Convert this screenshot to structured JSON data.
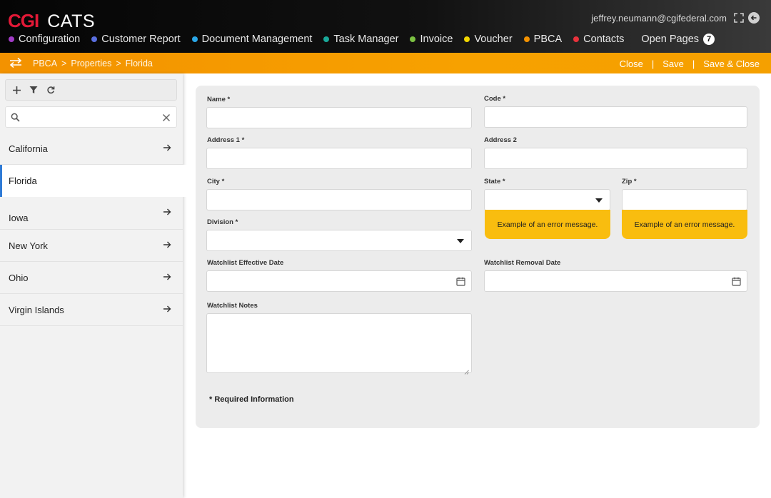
{
  "brand": {
    "logo": "CGI",
    "app_name": "CATS"
  },
  "user": {
    "email": "jeffrey.neumann@cgifederal.com"
  },
  "nav": {
    "items": [
      {
        "label": "Configuration",
        "color": "#a23cc7"
      },
      {
        "label": "Customer Report",
        "color": "#5a6fe0"
      },
      {
        "label": "Document Management",
        "color": "#2aa7e8"
      },
      {
        "label": "Task Manager",
        "color": "#1aa99a"
      },
      {
        "label": "Invoice",
        "color": "#7cc242"
      },
      {
        "label": "Voucher",
        "color": "#f2d600"
      },
      {
        "label": "PBCA",
        "color": "#f39200"
      },
      {
        "label": "Contacts",
        "color": "#e8323c"
      }
    ],
    "open_pages_label": "Open Pages",
    "open_pages_count": "7"
  },
  "breadcrumb": {
    "parts": [
      "PBCA",
      ">",
      "Properties",
      ">",
      "Florida"
    ]
  },
  "actions": {
    "close": "Close",
    "save": "Save",
    "save_close": "Save & Close",
    "separator": "|"
  },
  "sidebar": {
    "search_placeholder": "",
    "items": [
      {
        "label": "California"
      },
      {
        "label": "Florida"
      },
      {
        "label": "Iowa"
      },
      {
        "label": "New York"
      },
      {
        "label": "Ohio"
      },
      {
        "label": "Virgin Islands"
      }
    ]
  },
  "form": {
    "name_label": "Name *",
    "code_label": "Code *",
    "address1_label": "Address 1 *",
    "address2_label": "Address 2",
    "city_label": "City *",
    "state_label": "State *",
    "zip_label": "Zip *",
    "division_label": "Division *",
    "watch_eff_label": "Watchlist Effective Date",
    "watch_rem_label": "Watchlist Removal Date",
    "notes_label": "Watchlist Notes",
    "state_error": "Example of an error message.",
    "zip_error": "Example of an error message.",
    "required_note": "*  Required Information"
  },
  "colors": {
    "accent_orange": "#f39200",
    "error_yellow": "#f9bd0f",
    "active_blue": "#2f7bd6",
    "brand_red": "#e31937"
  }
}
